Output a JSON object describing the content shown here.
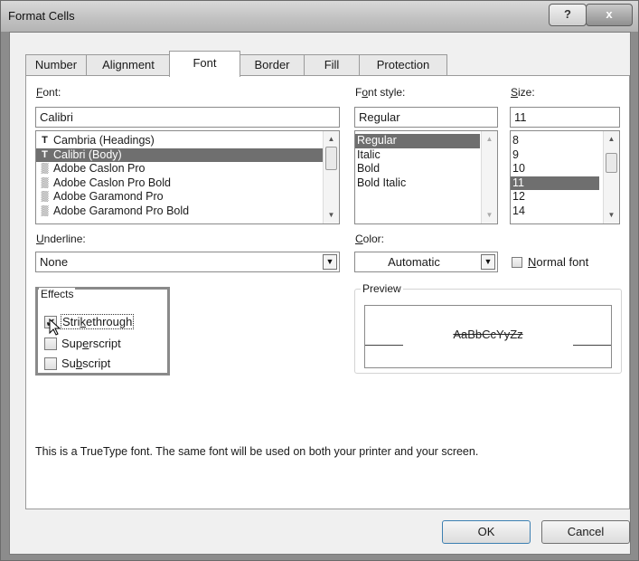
{
  "window": {
    "title": "Format Cells",
    "help_glyph": "?",
    "close_glyph": "x"
  },
  "tabs": [
    {
      "label": "Number"
    },
    {
      "label": "Alignment"
    },
    {
      "label": "Font"
    },
    {
      "label": "Border"
    },
    {
      "label": "Fill"
    },
    {
      "label": "Protection"
    }
  ],
  "active_tab": "Font",
  "font": {
    "label_u": "F",
    "label_rest": "ont:",
    "value": "Calibri",
    "items": [
      {
        "icon": "truetype-icon",
        "glyph": "T",
        "name": "Cambria (Headings)"
      },
      {
        "icon": "truetype-icon",
        "glyph": "T",
        "name": "Calibri (Body)",
        "selected": true
      },
      {
        "icon": "opentype-icon",
        "glyph": "▒",
        "name": "Adobe Caslon Pro"
      },
      {
        "icon": "opentype-icon",
        "glyph": "▒",
        "name": "Adobe Caslon Pro Bold"
      },
      {
        "icon": "opentype-icon",
        "glyph": "▒",
        "name": "Adobe Garamond Pro"
      },
      {
        "icon": "opentype-icon",
        "glyph": "▒",
        "name": "Adobe Garamond Pro Bold"
      }
    ]
  },
  "font_style": {
    "label_pre": "F",
    "label_u": "o",
    "label_rest": "nt style:",
    "value": "Regular",
    "items": [
      "Regular",
      "Italic",
      "Bold",
      "Bold Italic"
    ],
    "selected": "Regular"
  },
  "size": {
    "label_u": "S",
    "label_rest": "ize:",
    "value": "11",
    "items": [
      "8",
      "9",
      "10",
      "11",
      "12",
      "14"
    ],
    "selected": "11"
  },
  "underline": {
    "label_u": "U",
    "label_rest": "nderline:",
    "value": "None"
  },
  "color": {
    "label_u": "C",
    "label_rest": "olor:",
    "value": "Automatic"
  },
  "normal_font": {
    "label_u": "N",
    "label_rest": "ormal font",
    "checked": false
  },
  "effects": {
    "title": "Effects",
    "strikethrough": {
      "pre": "Stri",
      "u": "k",
      "post": "ethrough",
      "checked": true
    },
    "superscript": {
      "pre": "Sup",
      "u": "e",
      "post": "rscript",
      "checked": false
    },
    "subscript": {
      "pre": "Su",
      "u": "b",
      "post": "script",
      "checked": false
    }
  },
  "preview": {
    "title": "Preview",
    "sample": "AaBbCcYyZz"
  },
  "info_text": "This is a TrueType font.  The same font will be used on both your printer and your screen.",
  "buttons": {
    "ok": "OK",
    "cancel": "Cancel"
  },
  "checkmark": "✔",
  "icons": {
    "up": "▲",
    "down": "▼"
  }
}
